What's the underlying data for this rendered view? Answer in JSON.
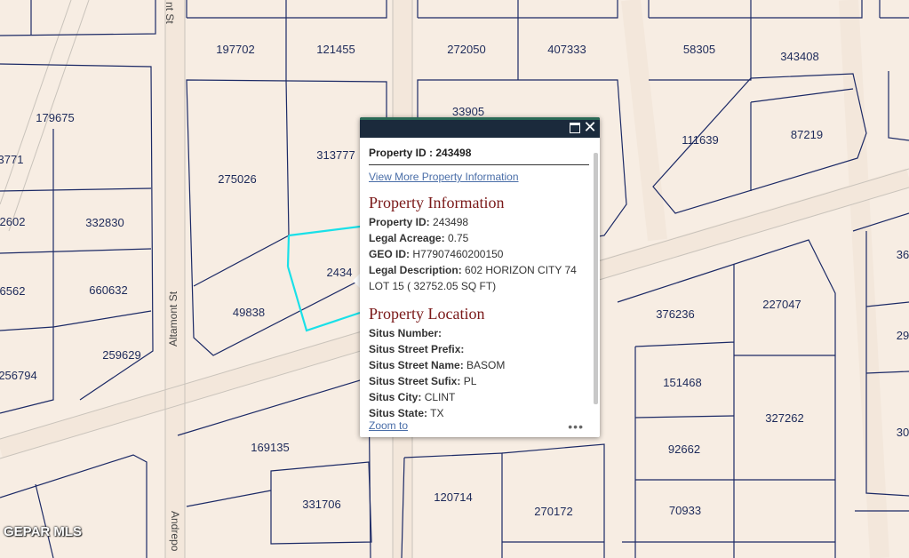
{
  "map": {
    "parcels": [
      {
        "id": "197702"
      },
      {
        "id": "121455"
      },
      {
        "id": "272050"
      },
      {
        "id": "407333"
      },
      {
        "id": "58305"
      },
      {
        "id": "343408"
      },
      {
        "id": "179675"
      },
      {
        "id": "33905"
      },
      {
        "id": "111639"
      },
      {
        "id": "87219"
      },
      {
        "id": "3771"
      },
      {
        "id": "275026"
      },
      {
        "id": "313777"
      },
      {
        "id": "2602"
      },
      {
        "id": "332830"
      },
      {
        "id": "6562"
      },
      {
        "id": "660632"
      },
      {
        "id": "2434"
      },
      {
        "id": "49838"
      },
      {
        "id": "259629"
      },
      {
        "id": "256794"
      },
      {
        "id": "376236"
      },
      {
        "id": "227047"
      },
      {
        "id": "36"
      },
      {
        "id": "29"
      },
      {
        "id": "151468"
      },
      {
        "id": "327262"
      },
      {
        "id": "30"
      },
      {
        "id": "169135"
      },
      {
        "id": "92662"
      },
      {
        "id": "331706"
      },
      {
        "id": "120714"
      },
      {
        "id": "270172"
      },
      {
        "id": "70933"
      }
    ],
    "streets": [
      "nt St",
      "Altamont St",
      "Andrepo"
    ],
    "attribution": "GEPAR MLS",
    "colors": {
      "background": "#f7ede3",
      "road": "#f2e6da",
      "parcel_line": "#1c2a66",
      "selected": "#19e0e8"
    }
  },
  "popup": {
    "header": "Property ID : 243498",
    "view_more": "View More Property Information",
    "info_title": "Property Information",
    "info": [
      {
        "label": "Property ID:",
        "value": "243498"
      },
      {
        "label": "Legal Acreage:",
        "value": "0.75"
      },
      {
        "label": "GEO ID:",
        "value": "H77907460200150"
      },
      {
        "label": "Legal Description:",
        "value": "602 HORIZON CITY 74 LOT 15 ( 32752.05 SQ FT)"
      }
    ],
    "location_title": "Property Location",
    "location": [
      {
        "label": "Situs Number:",
        "value": ""
      },
      {
        "label": "Situs Street Prefix:",
        "value": ""
      },
      {
        "label": "Situs Street Name:",
        "value": "BASOM"
      },
      {
        "label": "Situs Street Sufix:",
        "value": "PL"
      },
      {
        "label": "Situs City:",
        "value": "CLINT"
      },
      {
        "label": "Situs State:",
        "value": "TX"
      }
    ],
    "zoom_to": "Zoom to",
    "more": "•••"
  }
}
